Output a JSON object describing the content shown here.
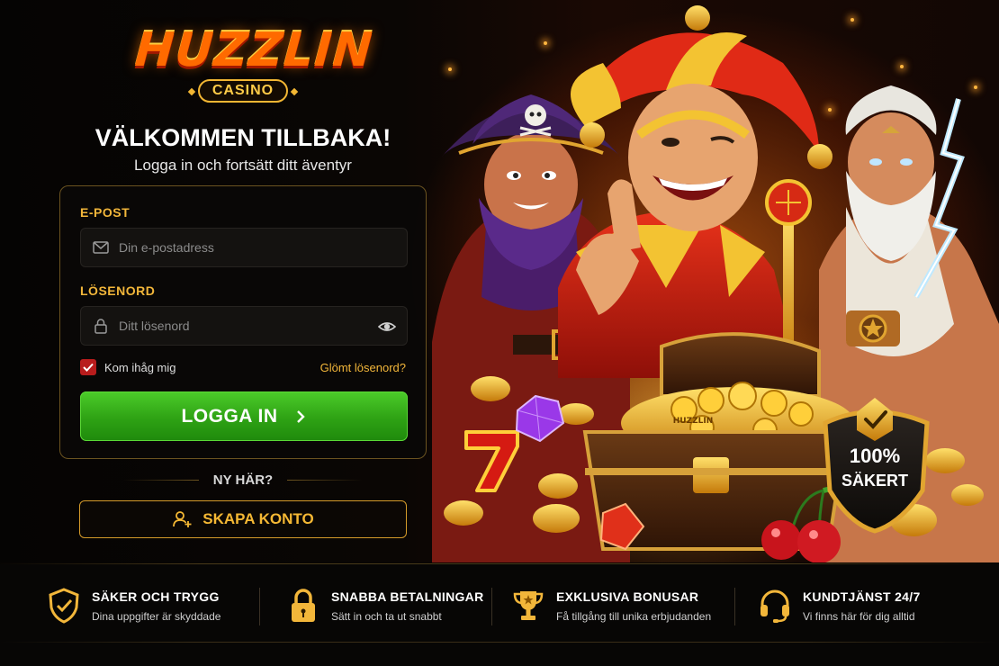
{
  "brand": {
    "name": "HUZZLIN",
    "subname": "CASINO"
  },
  "header": {
    "title": "VÄLKOMMEN TILLBAKA!",
    "subtitle": "Logga in och fortsätt ditt äventyr"
  },
  "form": {
    "email_label": "E-POST",
    "email_placeholder": "Din e-postadress",
    "email_value": "",
    "password_label": "LÖSENORD",
    "password_placeholder": "Ditt lösenord",
    "password_value": "",
    "remember_label": "Kom ihåg mig",
    "remember_checked": true,
    "forgot_label": "Glömt lösenord?",
    "login_label": "LOGGA IN"
  },
  "signup": {
    "prompt": "NY HÄR?",
    "create_label": "SKAPA KONTO"
  },
  "badge": {
    "line1": "100%",
    "line2": "SÄKERT"
  },
  "hero_chest_text": "HUZZLIN",
  "features": [
    {
      "icon": "shield-check-icon",
      "title": "SÄKER OCH TRYGG",
      "subtitle": "Dina uppgifter är skyddade"
    },
    {
      "icon": "padlock-icon",
      "title": "SNABBA BETALNINGAR",
      "subtitle": "Sätt in och ta ut snabbt"
    },
    {
      "icon": "trophy-icon",
      "title": "EXKLUSIVA BONUSAR",
      "subtitle": "Få tillgång till unika erbjudanden"
    },
    {
      "icon": "headset-icon",
      "title": "KUNDTJÄNST 24/7",
      "subtitle": "Vi finns här för dig alltid"
    }
  ],
  "colors": {
    "accent_gold": "#f2b63a",
    "login_green": "#2ea214",
    "checkbox_red": "#b81c1c",
    "brand_orange": "#ff6a00"
  }
}
